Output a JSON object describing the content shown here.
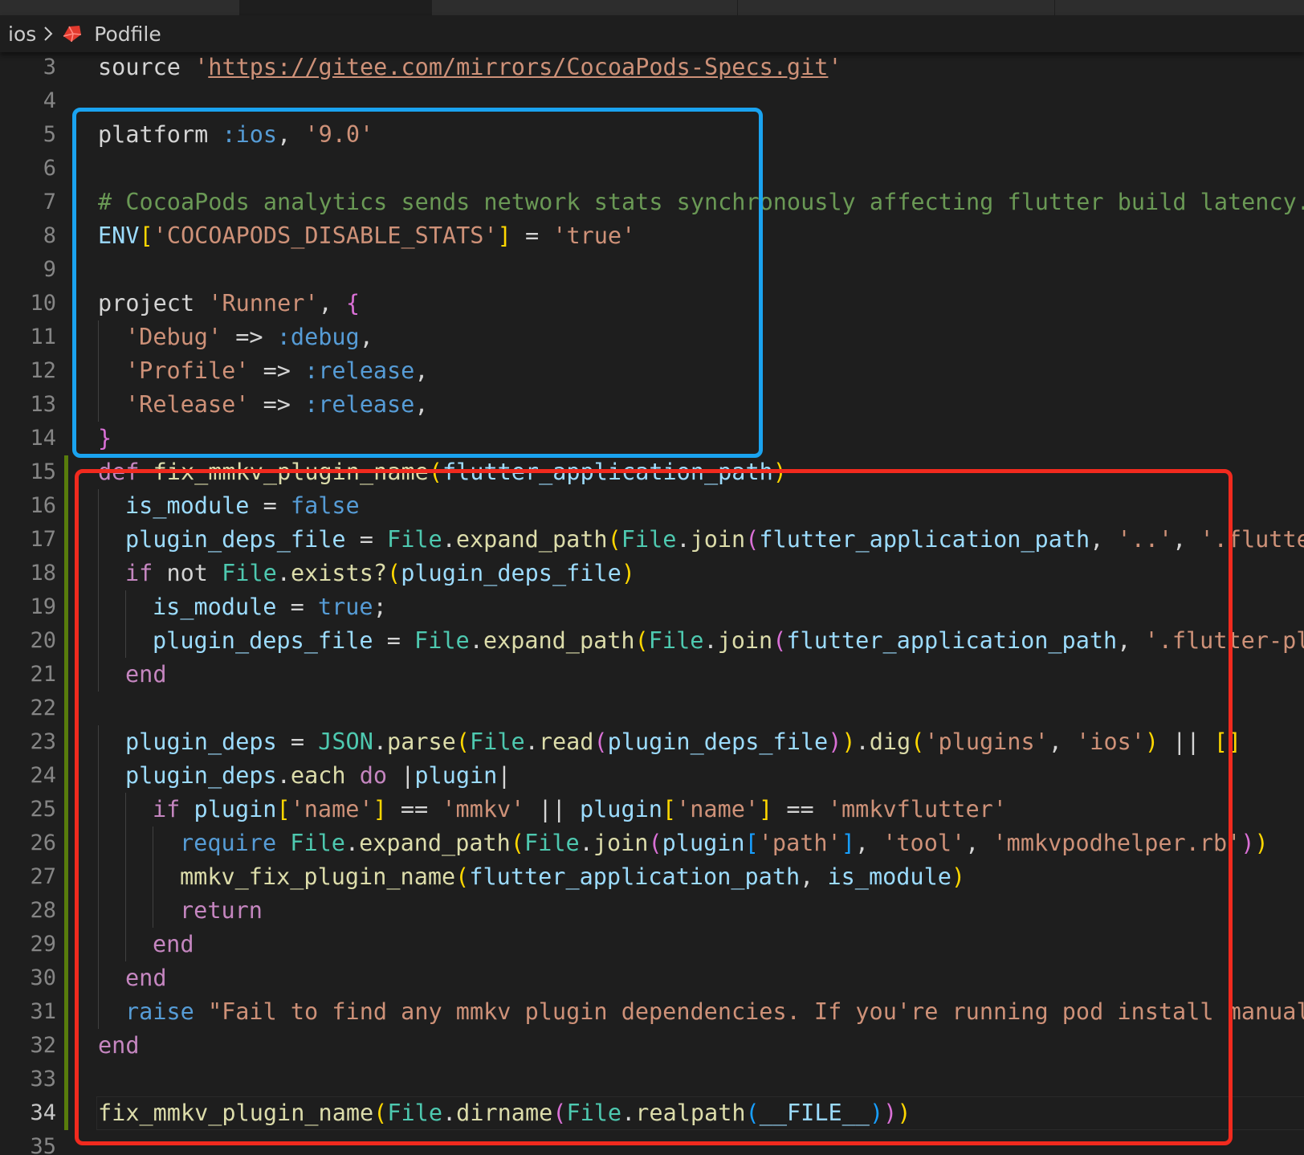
{
  "breadcrumb": {
    "folder": "ios",
    "file": "Podfile"
  },
  "icons": {
    "separator": "chevron-right-icon",
    "file": "ruby-file-icon"
  },
  "colors": {
    "background": "#1e1e1e",
    "highlight_blue": "#1aa3f0",
    "highlight_red": "#f12a1e",
    "git_modified": "#587c0c"
  },
  "lines": [
    {
      "n": "3",
      "indent": 0,
      "tokens": [
        [
          "plain",
          "source "
        ],
        [
          "str",
          "'"
        ],
        [
          "url",
          "https://gitee.com/mirrors/CocoaPods-Specs.git"
        ],
        [
          "str",
          "'"
        ]
      ]
    },
    {
      "n": "4",
      "indent": 0,
      "tokens": []
    },
    {
      "n": "5",
      "indent": 0,
      "tokens": [
        [
          "plain",
          "platform "
        ],
        [
          "sym",
          ":ios"
        ],
        [
          "plain",
          ", "
        ],
        [
          "str",
          "'9.0'"
        ]
      ]
    },
    {
      "n": "6",
      "indent": 0,
      "tokens": []
    },
    {
      "n": "7",
      "indent": 0,
      "tokens": [
        [
          "cmt",
          "# CocoaPods analytics sends network stats synchronously affecting flutter build latency."
        ]
      ]
    },
    {
      "n": "8",
      "indent": 0,
      "tokens": [
        [
          "var",
          "ENV"
        ],
        [
          "br1",
          "["
        ],
        [
          "str",
          "'COCOAPODS_DISABLE_STATS'"
        ],
        [
          "br1",
          "]"
        ],
        [
          "plain",
          " = "
        ],
        [
          "str",
          "'true'"
        ]
      ]
    },
    {
      "n": "9",
      "indent": 0,
      "tokens": []
    },
    {
      "n": "10",
      "indent": 0,
      "tokens": [
        [
          "plain",
          "project "
        ],
        [
          "str",
          "'Runner'"
        ],
        [
          "plain",
          ", "
        ],
        [
          "br2",
          "{"
        ]
      ]
    },
    {
      "n": "11",
      "indent": 1,
      "tokens": [
        [
          "str",
          "'Debug'"
        ],
        [
          "plain",
          " => "
        ],
        [
          "sym",
          ":debug"
        ],
        [
          "plain",
          ","
        ]
      ]
    },
    {
      "n": "12",
      "indent": 1,
      "tokens": [
        [
          "str",
          "'Profile'"
        ],
        [
          "plain",
          " => "
        ],
        [
          "sym",
          ":release"
        ],
        [
          "plain",
          ","
        ]
      ]
    },
    {
      "n": "13",
      "indent": 1,
      "tokens": [
        [
          "str",
          "'Release'"
        ],
        [
          "plain",
          " => "
        ],
        [
          "sym",
          ":release"
        ],
        [
          "plain",
          ","
        ]
      ]
    },
    {
      "n": "14",
      "indent": 0,
      "tokens": [
        [
          "br2",
          "}"
        ]
      ]
    },
    {
      "n": "15",
      "indent": 0,
      "git": true,
      "tokens": [
        [
          "kw",
          "def "
        ],
        [
          "fn",
          "fix_mmkv_plugin_name"
        ],
        [
          "br1",
          "("
        ],
        [
          "var",
          "flutter_application_path"
        ],
        [
          "br1",
          ")"
        ]
      ]
    },
    {
      "n": "16",
      "indent": 1,
      "git": true,
      "tokens": [
        [
          "var",
          "is_module"
        ],
        [
          "plain",
          " = "
        ],
        [
          "sym",
          "false"
        ]
      ]
    },
    {
      "n": "17",
      "indent": 1,
      "git": true,
      "tokens": [
        [
          "var",
          "plugin_deps_file"
        ],
        [
          "plain",
          " = "
        ],
        [
          "cls",
          "File"
        ],
        [
          "plain",
          "."
        ],
        [
          "fn",
          "expand_path"
        ],
        [
          "br1",
          "("
        ],
        [
          "cls",
          "File"
        ],
        [
          "plain",
          "."
        ],
        [
          "fn",
          "join"
        ],
        [
          "br2",
          "("
        ],
        [
          "var",
          "flutter_application_path"
        ],
        [
          "plain",
          ", "
        ],
        [
          "str",
          "'..'"
        ],
        [
          "plain",
          ", "
        ],
        [
          "str",
          "'.flutter-plugins-dependencies'"
        ],
        [
          "br2",
          ")"
        ],
        [
          "br1",
          ")"
        ]
      ]
    },
    {
      "n": "18",
      "indent": 1,
      "git": true,
      "tokens": [
        [
          "kw",
          "if "
        ],
        [
          "plain",
          "not "
        ],
        [
          "cls",
          "File"
        ],
        [
          "plain",
          "."
        ],
        [
          "fn",
          "exists?"
        ],
        [
          "br1",
          "("
        ],
        [
          "var",
          "plugin_deps_file"
        ],
        [
          "br1",
          ")"
        ]
      ]
    },
    {
      "n": "19",
      "indent": 2,
      "git": true,
      "tokens": [
        [
          "var",
          "is_module"
        ],
        [
          "plain",
          " = "
        ],
        [
          "sym",
          "true"
        ],
        [
          "plain",
          ";"
        ]
      ]
    },
    {
      "n": "20",
      "indent": 2,
      "git": true,
      "tokens": [
        [
          "var",
          "plugin_deps_file"
        ],
        [
          "plain",
          " = "
        ],
        [
          "cls",
          "File"
        ],
        [
          "plain",
          "."
        ],
        [
          "fn",
          "expand_path"
        ],
        [
          "br1",
          "("
        ],
        [
          "cls",
          "File"
        ],
        [
          "plain",
          "."
        ],
        [
          "fn",
          "join"
        ],
        [
          "br2",
          "("
        ],
        [
          "var",
          "flutter_application_path"
        ],
        [
          "plain",
          ", "
        ],
        [
          "str",
          "'.flutter-plugins-dependencies'"
        ],
        [
          "br2",
          ")"
        ],
        [
          "br1",
          ")"
        ]
      ]
    },
    {
      "n": "21",
      "indent": 1,
      "git": true,
      "tokens": [
        [
          "kw",
          "end"
        ]
      ]
    },
    {
      "n": "22",
      "indent": 0,
      "git": true,
      "tokens": []
    },
    {
      "n": "23",
      "indent": 1,
      "git": true,
      "tokens": [
        [
          "var",
          "plugin_deps"
        ],
        [
          "plain",
          " = "
        ],
        [
          "cls",
          "JSON"
        ],
        [
          "plain",
          "."
        ],
        [
          "fn",
          "parse"
        ],
        [
          "br1",
          "("
        ],
        [
          "cls",
          "File"
        ],
        [
          "plain",
          "."
        ],
        [
          "fn",
          "read"
        ],
        [
          "br2",
          "("
        ],
        [
          "var",
          "plugin_deps_file"
        ],
        [
          "br2",
          ")"
        ],
        [
          "br1",
          ")"
        ],
        [
          "plain",
          "."
        ],
        [
          "fn",
          "dig"
        ],
        [
          "br1",
          "("
        ],
        [
          "str",
          "'plugins'"
        ],
        [
          "plain",
          ", "
        ],
        [
          "str",
          "'ios'"
        ],
        [
          "br1",
          ")"
        ],
        [
          "plain",
          " || "
        ],
        [
          "br1",
          "[]"
        ]
      ]
    },
    {
      "n": "24",
      "indent": 1,
      "git": true,
      "tokens": [
        [
          "var",
          "plugin_deps"
        ],
        [
          "plain",
          "."
        ],
        [
          "fn",
          "each"
        ],
        [
          "kw",
          " do "
        ],
        [
          "plain",
          "|"
        ],
        [
          "var",
          "plugin"
        ],
        [
          "plain",
          "|"
        ]
      ]
    },
    {
      "n": "25",
      "indent": 2,
      "git": true,
      "tokens": [
        [
          "kw",
          "if "
        ],
        [
          "var",
          "plugin"
        ],
        [
          "br1",
          "["
        ],
        [
          "str",
          "'name'"
        ],
        [
          "br1",
          "]"
        ],
        [
          "plain",
          " == "
        ],
        [
          "str",
          "'mmkv'"
        ],
        [
          "plain",
          " || "
        ],
        [
          "var",
          "plugin"
        ],
        [
          "br1",
          "["
        ],
        [
          "str",
          "'name'"
        ],
        [
          "br1",
          "]"
        ],
        [
          "plain",
          " == "
        ],
        [
          "str",
          "'mmkvflutter'"
        ]
      ]
    },
    {
      "n": "26",
      "indent": 3,
      "git": true,
      "tokens": [
        [
          "sym",
          "require "
        ],
        [
          "cls",
          "File"
        ],
        [
          "plain",
          "."
        ],
        [
          "fn",
          "expand_path"
        ],
        [
          "br1",
          "("
        ],
        [
          "cls",
          "File"
        ],
        [
          "plain",
          "."
        ],
        [
          "fn",
          "join"
        ],
        [
          "br2",
          "("
        ],
        [
          "var",
          "plugin"
        ],
        [
          "br3",
          "["
        ],
        [
          "str",
          "'path'"
        ],
        [
          "br3",
          "]"
        ],
        [
          "plain",
          ", "
        ],
        [
          "str",
          "'tool'"
        ],
        [
          "plain",
          ", "
        ],
        [
          "str",
          "'mmkvpodhelper.rb'"
        ],
        [
          "br2",
          ")"
        ],
        [
          "br1",
          ")"
        ]
      ]
    },
    {
      "n": "27",
      "indent": 3,
      "git": true,
      "tokens": [
        [
          "fn",
          "mmkv_fix_plugin_name"
        ],
        [
          "br1",
          "("
        ],
        [
          "var",
          "flutter_application_path"
        ],
        [
          "plain",
          ", "
        ],
        [
          "var",
          "is_module"
        ],
        [
          "br1",
          ")"
        ]
      ]
    },
    {
      "n": "28",
      "indent": 3,
      "git": true,
      "tokens": [
        [
          "kw",
          "return"
        ]
      ]
    },
    {
      "n": "29",
      "indent": 2,
      "git": true,
      "tokens": [
        [
          "kw",
          "end"
        ]
      ]
    },
    {
      "n": "30",
      "indent": 1,
      "git": true,
      "tokens": [
        [
          "kw",
          "end"
        ]
      ]
    },
    {
      "n": "31",
      "indent": 1,
      "git": true,
      "tokens": [
        [
          "sym",
          "raise "
        ],
        [
          "str",
          "\"Fail to find any mmkv plugin dependencies. If you're running pod install manually, make sure flutter pub get is run first\""
        ]
      ]
    },
    {
      "n": "32",
      "indent": 0,
      "git": true,
      "tokens": [
        [
          "kw",
          "end"
        ]
      ]
    },
    {
      "n": "33",
      "indent": 0,
      "git": true,
      "tokens": []
    },
    {
      "n": "34",
      "indent": 0,
      "git": true,
      "current": true,
      "tokens": [
        [
          "fn",
          "fix_mmkv_plugin_name"
        ],
        [
          "br1",
          "("
        ],
        [
          "cls",
          "File"
        ],
        [
          "plain",
          "."
        ],
        [
          "fn",
          "dirname"
        ],
        [
          "br2",
          "("
        ],
        [
          "cls",
          "File"
        ],
        [
          "plain",
          "."
        ],
        [
          "fn",
          "realpath"
        ],
        [
          "br3",
          "("
        ],
        [
          "var",
          "__FILE__"
        ],
        [
          "br3",
          ")"
        ],
        [
          "br2",
          ")"
        ],
        [
          "br1",
          ")"
        ]
      ]
    },
    {
      "n": "35",
      "indent": 0,
      "tokens": []
    }
  ]
}
